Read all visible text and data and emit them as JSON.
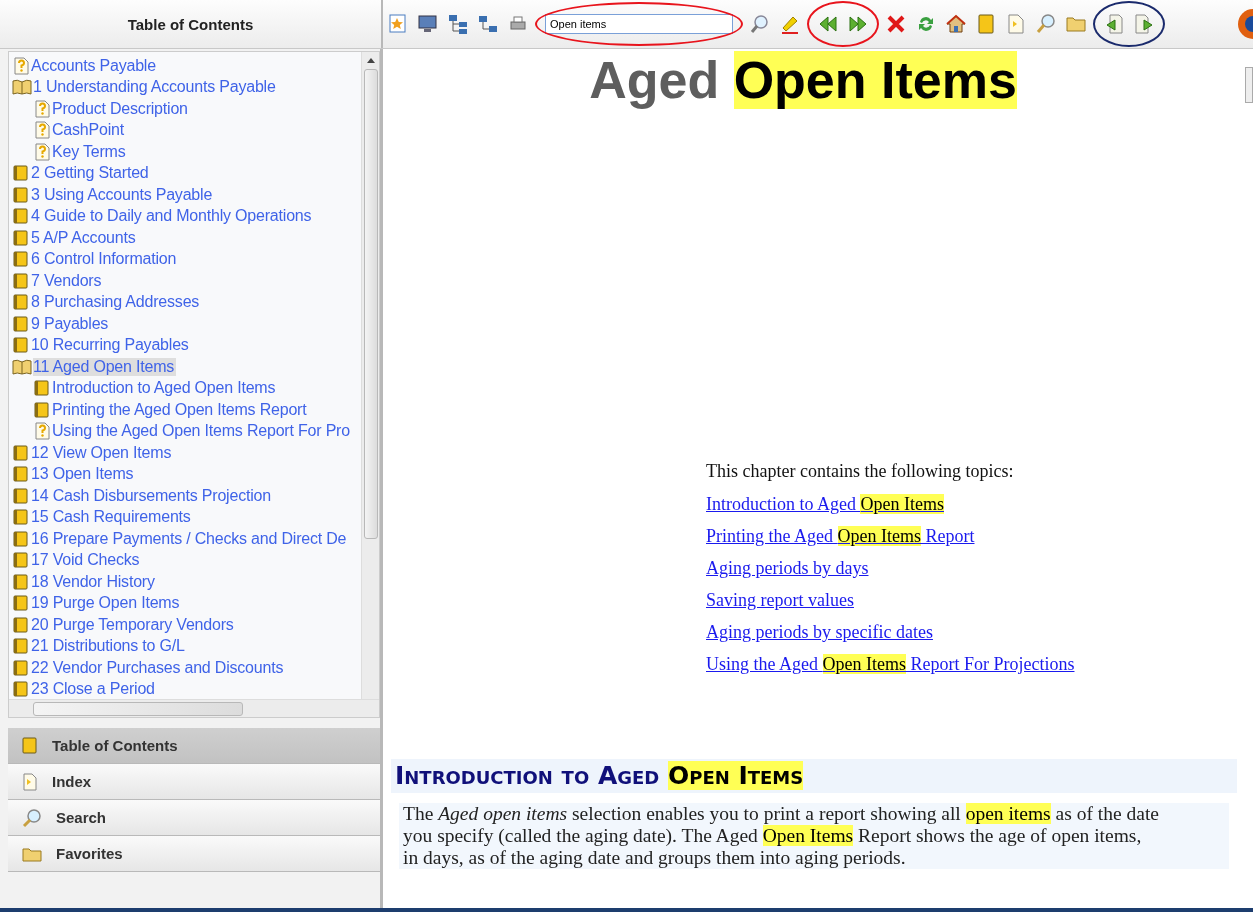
{
  "sidebar": {
    "title": "Table of Contents",
    "tree": [
      {
        "label": "Accounts Payable",
        "kind": "topic",
        "selected": false
      },
      {
        "label": "1 Understanding Accounts Payable",
        "kind": "open-book",
        "selected": false,
        "children": [
          {
            "label": "Product Description",
            "kind": "topic",
            "selected": false
          },
          {
            "label": "CashPoint",
            "kind": "topic",
            "selected": false
          },
          {
            "label": "Key Terms",
            "kind": "topic",
            "selected": false
          }
        ]
      },
      {
        "label": "2 Getting Started",
        "kind": "book",
        "selected": false
      },
      {
        "label": "3 Using Accounts Payable",
        "kind": "book",
        "selected": false
      },
      {
        "label": "4 Guide to Daily and Monthly Operations",
        "kind": "book",
        "selected": false
      },
      {
        "label": "5 A/P Accounts",
        "kind": "book",
        "selected": false
      },
      {
        "label": "6 Control Information",
        "kind": "book",
        "selected": false
      },
      {
        "label": "7 Vendors",
        "kind": "book",
        "selected": false
      },
      {
        "label": "8 Purchasing Addresses",
        "kind": "book",
        "selected": false
      },
      {
        "label": "9 Payables",
        "kind": "book",
        "selected": false
      },
      {
        "label": "10 Recurring Payables",
        "kind": "book",
        "selected": false
      },
      {
        "label": "11 Aged Open Items",
        "kind": "open-book",
        "selected": true,
        "children": [
          {
            "label": "Introduction to Aged Open Items",
            "kind": "book",
            "selected": false
          },
          {
            "label": "Printing the Aged Open Items Report",
            "kind": "book",
            "selected": false
          },
          {
            "label": "Using the Aged Open Items Report For Pro",
            "kind": "topic",
            "selected": false
          }
        ]
      },
      {
        "label": "12 View Open Items",
        "kind": "book",
        "selected": false
      },
      {
        "label": "13 Open Items",
        "kind": "book",
        "selected": false
      },
      {
        "label": "14 Cash Disbursements Projection",
        "kind": "book",
        "selected": false
      },
      {
        "label": "15 Cash Requirements",
        "kind": "book",
        "selected": false
      },
      {
        "label": "16 Prepare Payments / Checks and Direct De",
        "kind": "book",
        "selected": false
      },
      {
        "label": "17 Void Checks",
        "kind": "book",
        "selected": false
      },
      {
        "label": "18 Vendor History",
        "kind": "book",
        "selected": false
      },
      {
        "label": "19 Purge Open Items",
        "kind": "book",
        "selected": false
      },
      {
        "label": "20 Purge Temporary Vendors",
        "kind": "book",
        "selected": false
      },
      {
        "label": "21 Distributions to G/L",
        "kind": "book",
        "selected": false
      },
      {
        "label": "22 Vendor Purchases and Discounts",
        "kind": "book",
        "selected": false
      },
      {
        "label": "23 Close a Period",
        "kind": "book",
        "selected": false
      }
    ],
    "nav": [
      {
        "label": "Table of Contents",
        "kind": "contents",
        "selected": true
      },
      {
        "label": "Index",
        "kind": "index",
        "selected": false
      },
      {
        "label": "Search",
        "kind": "search",
        "selected": false
      },
      {
        "label": "Favorites",
        "kind": "favorites",
        "selected": false
      }
    ]
  },
  "toolbar": {
    "items": [
      {
        "kind": "button"
      },
      {
        "kind": "button"
      },
      {
        "kind": "button"
      },
      {
        "kind": "button"
      },
      {
        "kind": "button"
      },
      {
        "kind": "group",
        "color": "#e8141c",
        "items": [
          {
            "kind": "field",
            "value": "Open items"
          }
        ]
      },
      {
        "kind": "button"
      },
      {
        "kind": "button"
      },
      {
        "kind": "group",
        "color": "#e8141c",
        "items": [
          {
            "kind": "button"
          },
          {
            "kind": "button"
          }
        ]
      },
      {
        "kind": "button"
      },
      {
        "kind": "button"
      },
      {
        "kind": "button"
      },
      {
        "kind": "button"
      },
      {
        "kind": "button"
      },
      {
        "kind": "button"
      },
      {
        "kind": "button"
      },
      {
        "kind": "group",
        "color": "#1a2a6c",
        "items": [
          {
            "kind": "button"
          },
          {
            "kind": "button"
          }
        ]
      }
    ]
  },
  "content": {
    "title": [
      {
        "text": "Aged "
      },
      {
        "text": "Open Items",
        "highlight": true
      }
    ],
    "intro": "This chapter contains the following topics:",
    "links": [
      [
        {
          "text": "Introduction to Aged "
        },
        {
          "text": "Open Items",
          "highlight": true
        }
      ],
      [
        {
          "text": "Printing the Aged "
        },
        {
          "text": "Open Items",
          "highlight": true
        },
        {
          "text": " Report"
        }
      ],
      [
        {
          "text": "Aging periods by days"
        }
      ],
      [
        {
          "text": "Saving report values"
        }
      ],
      [
        {
          "text": "Aging periods by specific dates"
        }
      ],
      [
        {
          "text": "Using the Aged "
        },
        {
          "text": "Open Items",
          "highlight": true
        },
        {
          "text": " Report For Projections"
        }
      ]
    ],
    "section_heading": [
      {
        "text": "Introduction to Aged "
      },
      {
        "text": "Open Items",
        "highlight": true
      }
    ],
    "paragraph": [
      {
        "text": "The "
      },
      {
        "text": "Aged open items",
        "italic": true
      },
      {
        "text": " selection enables you to print a report showing all "
      },
      {
        "text": "open items",
        "highlight": true
      },
      {
        "text": " as of the date you specify (called the aging date). The Aged "
      },
      {
        "text": "Open Items",
        "highlight": true
      },
      {
        "text": " Report shows the age of open items, in days, as of the aging date and groups them into aging periods."
      }
    ]
  }
}
